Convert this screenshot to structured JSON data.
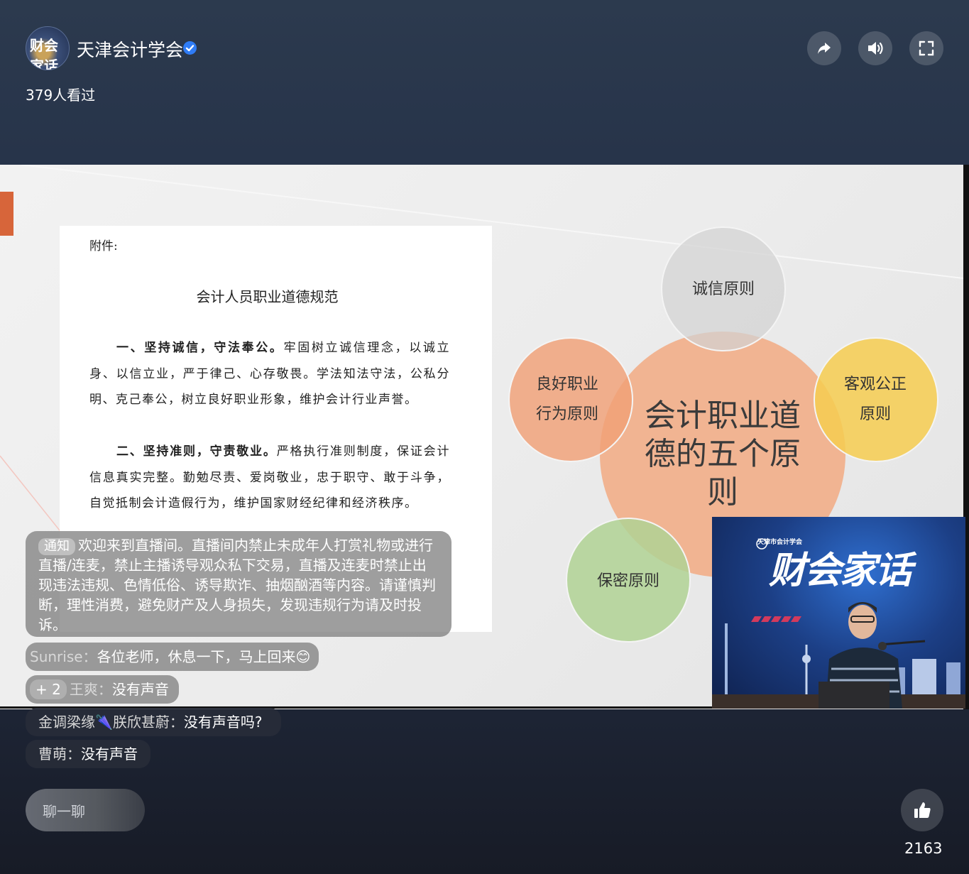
{
  "header": {
    "channel_name": "天津会计学会",
    "avatar_text": "财会家话",
    "views": "379人看过",
    "icons": [
      "share-icon",
      "volume-icon",
      "fullscreen-icon"
    ]
  },
  "slide": {
    "doc": {
      "heading": "附件:",
      "title": "会计人员职业道德规范",
      "p1_bold": "一、坚持诚信，守法奉公。",
      "p1_text": "牢固树立诚信理念，以诚立身、以信立业，严于律己、心存敬畏。学法知法守法，公私分明、克己奉公，树立良好职业形象，维护会计行业声誉。",
      "p2_bold": "二、坚持准则，守责敬业。",
      "p2_text": "严格执行准则制度，保证会计信息真实完整。勤勉尽责、爱岗敬业，忠于职守、敢于斗争，自觉抵制会计造假行为，维护国家财经纪律和经济秩序。"
    },
    "diagram": {
      "center": "会计职业道德的五个原则",
      "top": "诚信原则",
      "left": "良好职业行为原则",
      "right": "客观公正原则",
      "bottom": "保密原则"
    }
  },
  "pip": {
    "org_text": "天津市会计学会",
    "brand_text": "财会家话"
  },
  "chat": {
    "notice_tag": "通知",
    "notice_text": "欢迎来到直播间。直播间内禁止未成年人打赏礼物或进行直播/连麦，禁止主播诱导观众私下交易，直播及连麦时禁止出现违法违规、色情低俗、诱导欺诈、抽烟酗酒等内容。请谨慎判断，理性消费，避免财产及人身损失，发现违规行为请及时投诉。",
    "messages": [
      {
        "user": "Sunrise：",
        "text": "各位老师，休息一下，马上回来😊"
      },
      {
        "badge": "+ 2",
        "user": "王爽：",
        "text": "没有声音"
      },
      {
        "user": "金调梁缘🌂朕欣甚蔚：",
        "text": "没有声音吗?"
      },
      {
        "user": "曹萌：",
        "text": "没有声音"
      }
    ]
  },
  "footer": {
    "input_placeholder": "聊一聊",
    "like_count": "2163"
  },
  "colors": {
    "accent_verified": "#2f7cf6",
    "center_circle": "#f2b28d",
    "top_circle": "#d9d9d9",
    "left_circle": "#f0a57e",
    "right_circle": "#f6cf5c",
    "bottom_circle": "#b5d39a"
  }
}
